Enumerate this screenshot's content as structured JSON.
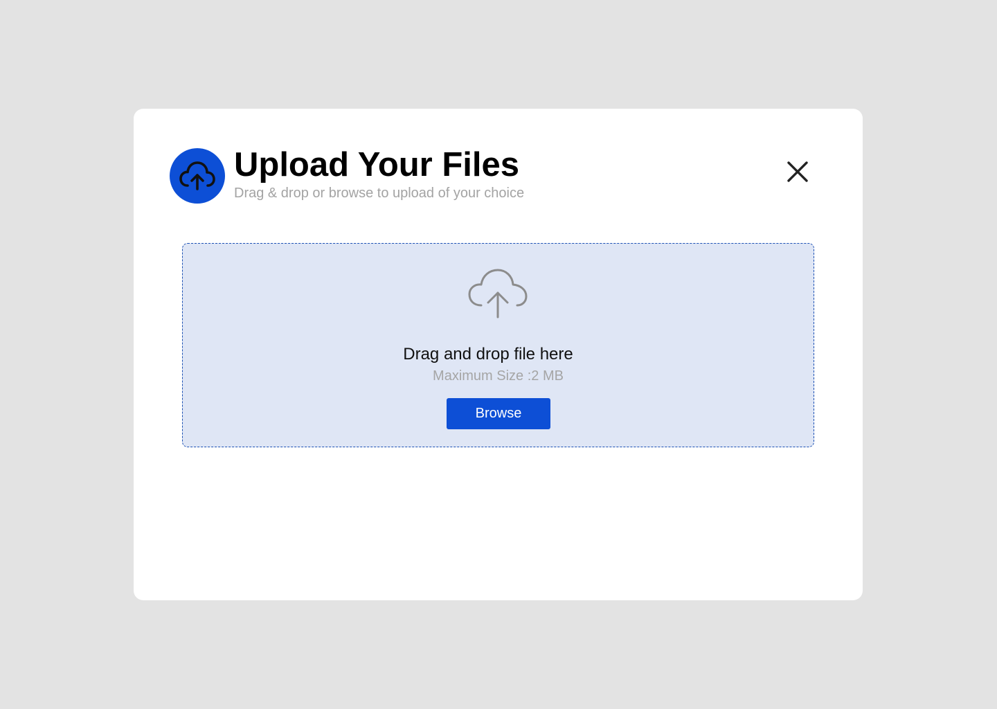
{
  "dialog": {
    "title": "Upload Your Files",
    "subtitle": "Drag & drop or browse to upload of your choice",
    "header_icon": "cloud-upload-icon",
    "close_icon": "close-icon",
    "accent_color": "#0d4fd6"
  },
  "dropzone": {
    "icon": "cloud-upload-icon",
    "title": "Drag and drop file here",
    "hint": "Maximum Size :2 MB",
    "browse_label": "Browse",
    "background_color": "#dfe6f5"
  }
}
